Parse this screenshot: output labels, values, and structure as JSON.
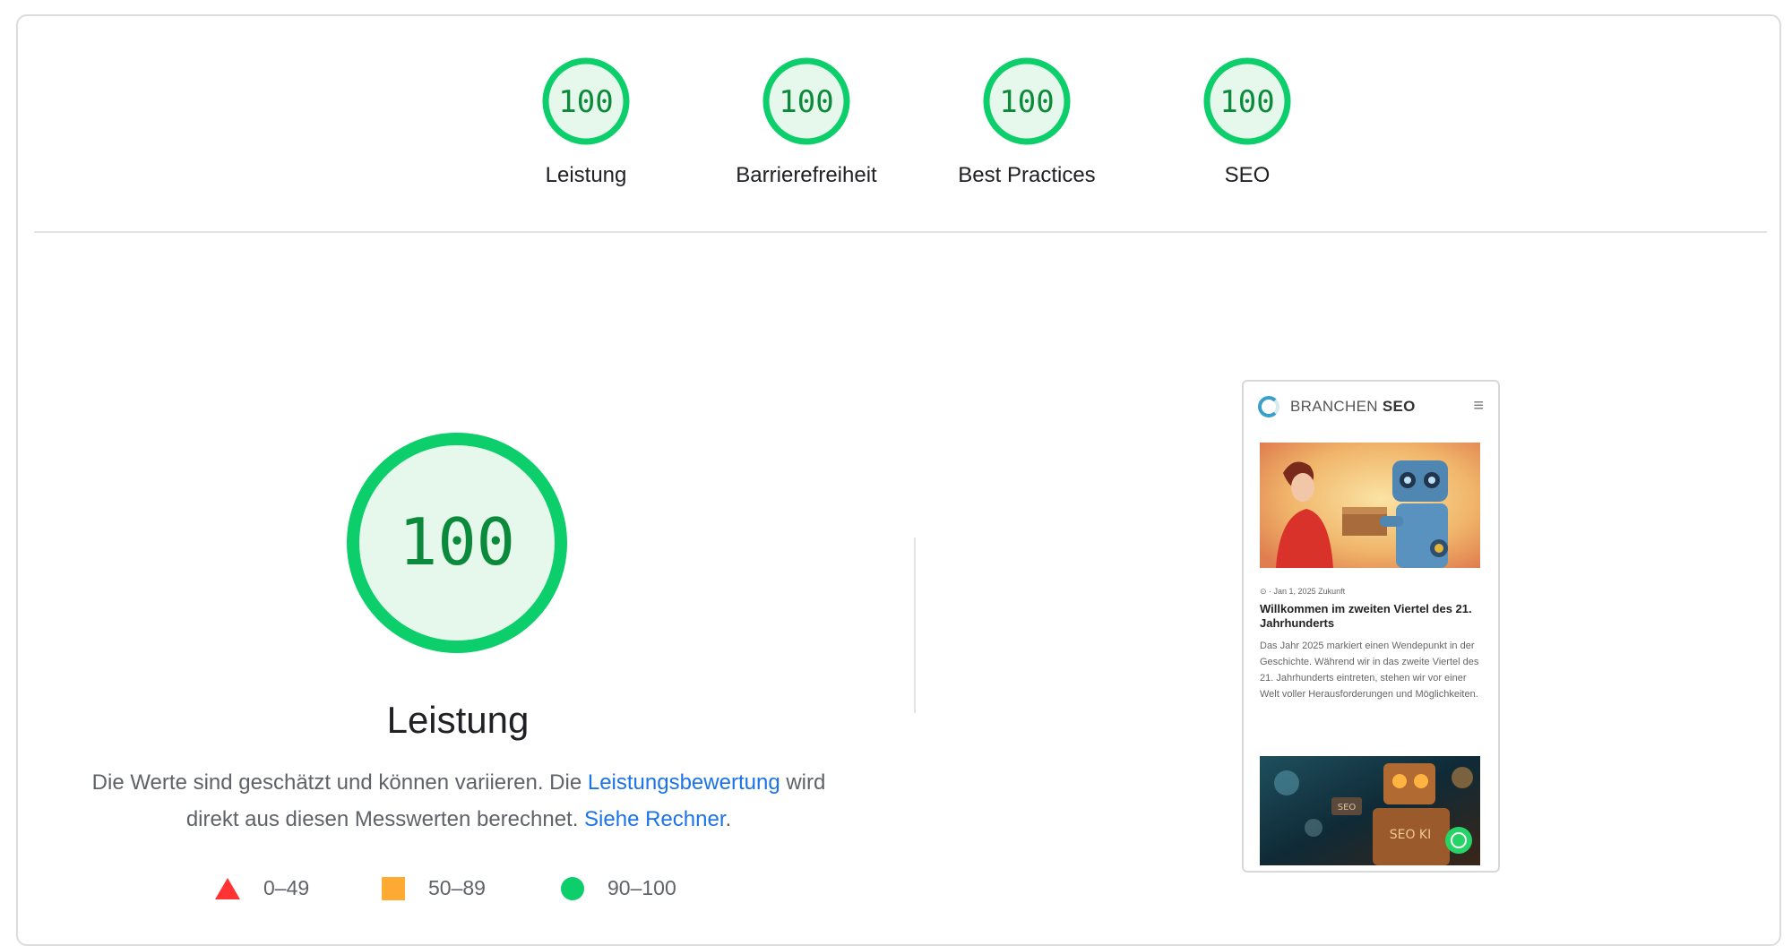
{
  "gauges": [
    {
      "score": "100",
      "label": "Leistung"
    },
    {
      "score": "100",
      "label": "Barrierefreiheit"
    },
    {
      "score": "100",
      "label": "Best Practices"
    },
    {
      "score": "100",
      "label": "SEO"
    }
  ],
  "performance": {
    "score": "100",
    "title": "Leistung",
    "desc_part1": "Die Werte sind geschätzt und können variieren. Die ",
    "desc_link1": "Leistungsbewertung",
    "desc_part2": " wird direkt aus diesen Messwerten berechnet. ",
    "desc_link2": "Siehe Rechner",
    "desc_end": "."
  },
  "legend": [
    {
      "range": "0–49",
      "shape": "triangle",
      "color": "#ff3333"
    },
    {
      "range": "50–89",
      "shape": "square",
      "color": "#ffaa33"
    },
    {
      "range": "90–100",
      "shape": "circle",
      "color": "#0cce6b"
    }
  ],
  "colors": {
    "pass": "#0cce6b",
    "pass_fill": "#e6f7ec",
    "pass_text": "#0b8a3b",
    "link": "#1a73e8"
  },
  "screenshot": {
    "brand_light": "BRANCHEN",
    "brand_bold": "SEO",
    "menu_icon": "≡",
    "post_meta": "⊙ · Jan 1, 2025 Zukunft",
    "post_title": "Willkommen im zweiten Viertel des 21. Jahrhunderts",
    "post_excerpt": "Das Jahr 2025 markiert einen Wendepunkt in der Geschichte. Während wir in das zweite Viertel des 21. Jahrhunderts eintreten, stehen wir vor einer Welt voller Herausforderungen und Möglichkeiten.",
    "robot_sign": "SEO",
    "robot_badge": "SEO KI"
  }
}
